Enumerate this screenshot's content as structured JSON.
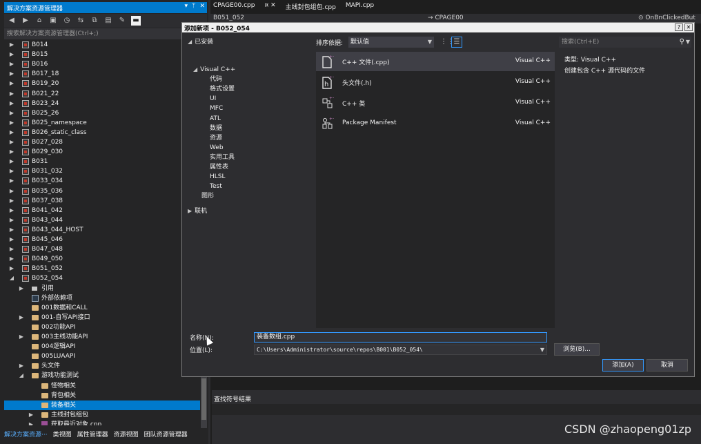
{
  "solution_explorer": {
    "title": "解决方案资源管理器",
    "title_buttons": [
      "▾",
      "ᛘ",
      "✕"
    ],
    "search_placeholder": "搜索解决方案资源管理器(Ctrl+;)",
    "tree": [
      {
        "label": "B014",
        "level": 0,
        "arrow": "▶",
        "icon": "proj"
      },
      {
        "label": "B015",
        "level": 0,
        "arrow": "▶",
        "icon": "proj"
      },
      {
        "label": "B016",
        "level": 0,
        "arrow": "▶",
        "icon": "proj"
      },
      {
        "label": "B017_18",
        "level": 0,
        "arrow": "▶",
        "icon": "proj"
      },
      {
        "label": "B019_20",
        "level": 0,
        "arrow": "▶",
        "icon": "proj"
      },
      {
        "label": "B021_22",
        "level": 0,
        "arrow": "▶",
        "icon": "proj"
      },
      {
        "label": "B023_24",
        "level": 0,
        "arrow": "▶",
        "icon": "proj"
      },
      {
        "label": "B025_26",
        "level": 0,
        "arrow": "▶",
        "icon": "proj"
      },
      {
        "label": "B025_namespace",
        "level": 0,
        "arrow": "▶",
        "icon": "proj"
      },
      {
        "label": "B026_static_class",
        "level": 0,
        "arrow": "▶",
        "icon": "proj"
      },
      {
        "label": "B027_028",
        "level": 0,
        "arrow": "▶",
        "icon": "proj"
      },
      {
        "label": "B029_030",
        "level": 0,
        "arrow": "▶",
        "icon": "proj"
      },
      {
        "label": "B031",
        "level": 0,
        "arrow": "▶",
        "icon": "proj"
      },
      {
        "label": "B031_032",
        "level": 0,
        "arrow": "▶",
        "icon": "proj"
      },
      {
        "label": "B033_034",
        "level": 0,
        "arrow": "▶",
        "icon": "proj"
      },
      {
        "label": "B035_036",
        "level": 0,
        "arrow": "▶",
        "icon": "proj"
      },
      {
        "label": "B037_038",
        "level": 0,
        "arrow": "▶",
        "icon": "proj"
      },
      {
        "label": "B041_042",
        "level": 0,
        "arrow": "▶",
        "icon": "proj"
      },
      {
        "label": "B043_044",
        "level": 0,
        "arrow": "▶",
        "icon": "proj"
      },
      {
        "label": "B043_044_HOST",
        "level": 0,
        "arrow": "▶",
        "icon": "proj"
      },
      {
        "label": "B045_046",
        "level": 0,
        "arrow": "▶",
        "icon": "proj"
      },
      {
        "label": "B047_048",
        "level": 0,
        "arrow": "▶",
        "icon": "proj"
      },
      {
        "label": "B049_050",
        "level": 0,
        "arrow": "▶",
        "icon": "proj"
      },
      {
        "label": "B051_052",
        "level": 0,
        "arrow": "▶",
        "icon": "proj"
      },
      {
        "label": "B052_054",
        "level": 0,
        "arrow": "◢",
        "icon": "proj"
      },
      {
        "label": "引用",
        "level": 1,
        "arrow": "▶",
        "icon": "ref"
      },
      {
        "label": "外部依赖项",
        "level": 1,
        "arrow": "",
        "icon": "ext"
      },
      {
        "label": "001数据和CALL",
        "level": 1,
        "arrow": "",
        "icon": "folder"
      },
      {
        "label": "001-自写API接口",
        "level": 1,
        "arrow": "▶",
        "icon": "folder"
      },
      {
        "label": "002功能API",
        "level": 1,
        "arrow": "",
        "icon": "folder"
      },
      {
        "label": "003主线功能API",
        "level": 1,
        "arrow": "▶",
        "icon": "folder"
      },
      {
        "label": "004逻辑API",
        "level": 1,
        "arrow": "",
        "icon": "folder"
      },
      {
        "label": "005LUAAPI",
        "level": 1,
        "arrow": "",
        "icon": "folder"
      },
      {
        "label": "头文件",
        "level": 1,
        "arrow": "▶",
        "icon": "folder"
      },
      {
        "label": "游戏功能测试",
        "level": 1,
        "arrow": "◢",
        "icon": "folder"
      },
      {
        "label": "怪物相关",
        "level": 2,
        "arrow": "",
        "icon": "folder"
      },
      {
        "label": "背包相关",
        "level": 2,
        "arrow": "",
        "icon": "folder"
      },
      {
        "label": "装备相关",
        "level": 2,
        "arrow": "",
        "icon": "folder",
        "selected": true
      },
      {
        "label": "主线封包组包",
        "level": 2,
        "arrow": "▶",
        "icon": "folder"
      },
      {
        "label": "获取最近对象.cpp",
        "level": 2,
        "arrow": "▶",
        "icon": "cpp"
      }
    ],
    "bottom_tabs": [
      "解决方案资源···",
      "类视图",
      "属性管理器",
      "资源视图",
      "团队资源管理器"
    ]
  },
  "editor": {
    "tabs": [
      "CPAGE00.cpp",
      "主线封包组包.cpp",
      "MAPI.cpp"
    ],
    "tab_controls": "¤ ✕",
    "nav_left": "B051_052",
    "nav_middle": "→ CPAGE00",
    "nav_right": "⊙ OnBnClickedBut",
    "symbol_results_title": "查找符号结果"
  },
  "dialog": {
    "title": "添加新项 - B052_054",
    "help_button": "?",
    "close_button": "✕",
    "installed_label": "已安装",
    "categories": [
      {
        "label": "Visual C++",
        "level": 1,
        "arrow": "◢"
      },
      {
        "label": "代码",
        "level": 2
      },
      {
        "label": "格式设置",
        "level": 2
      },
      {
        "label": "UI",
        "level": 2
      },
      {
        "label": "MFC",
        "level": 2
      },
      {
        "label": "ATL",
        "level": 2
      },
      {
        "label": "数据",
        "level": 2
      },
      {
        "label": "资源",
        "level": 2
      },
      {
        "label": "Web",
        "level": 2
      },
      {
        "label": "实用工具",
        "level": 2
      },
      {
        "label": "属性表",
        "level": 2
      },
      {
        "label": "HLSL",
        "level": 2
      },
      {
        "label": "Test",
        "level": 2
      },
      {
        "label": "图形",
        "level": 1
      }
    ],
    "online_label": "联机",
    "sort_label": "排序依据:",
    "sort_value": "默认值",
    "templates": [
      {
        "name": "C++ 文件(.cpp)",
        "lang": "Visual C++",
        "icon": "cpp-file-icon",
        "selected": true
      },
      {
        "name": "头文件(.h)",
        "lang": "Visual C++",
        "icon": "header-file-icon"
      },
      {
        "name": "C++ 类",
        "lang": "Visual C++",
        "icon": "cpp-class-icon"
      },
      {
        "name": "Package Manifest",
        "lang": "Visual C++",
        "icon": "package-manifest-icon"
      }
    ],
    "search_placeholder": "搜索(Ctrl+E)",
    "detail_type": "类型:  Visual C++",
    "detail_desc": "创建包含 C++ 源代码的文件",
    "name_label": "名称(N):",
    "name_value": "装备数组.cpp",
    "location_label": "位置(L):",
    "location_value": "C:\\Users\\Administrator\\source\\repos\\B001\\B052_054\\",
    "browse_button": "浏览(B)...",
    "add_button": "添加(A)",
    "cancel_button": "取消"
  },
  "watermark": "CSDN @zhaopeng01zp",
  "colors": {
    "accent": "#007acc",
    "selection": "#3399ff",
    "background": "#2d2d30"
  }
}
